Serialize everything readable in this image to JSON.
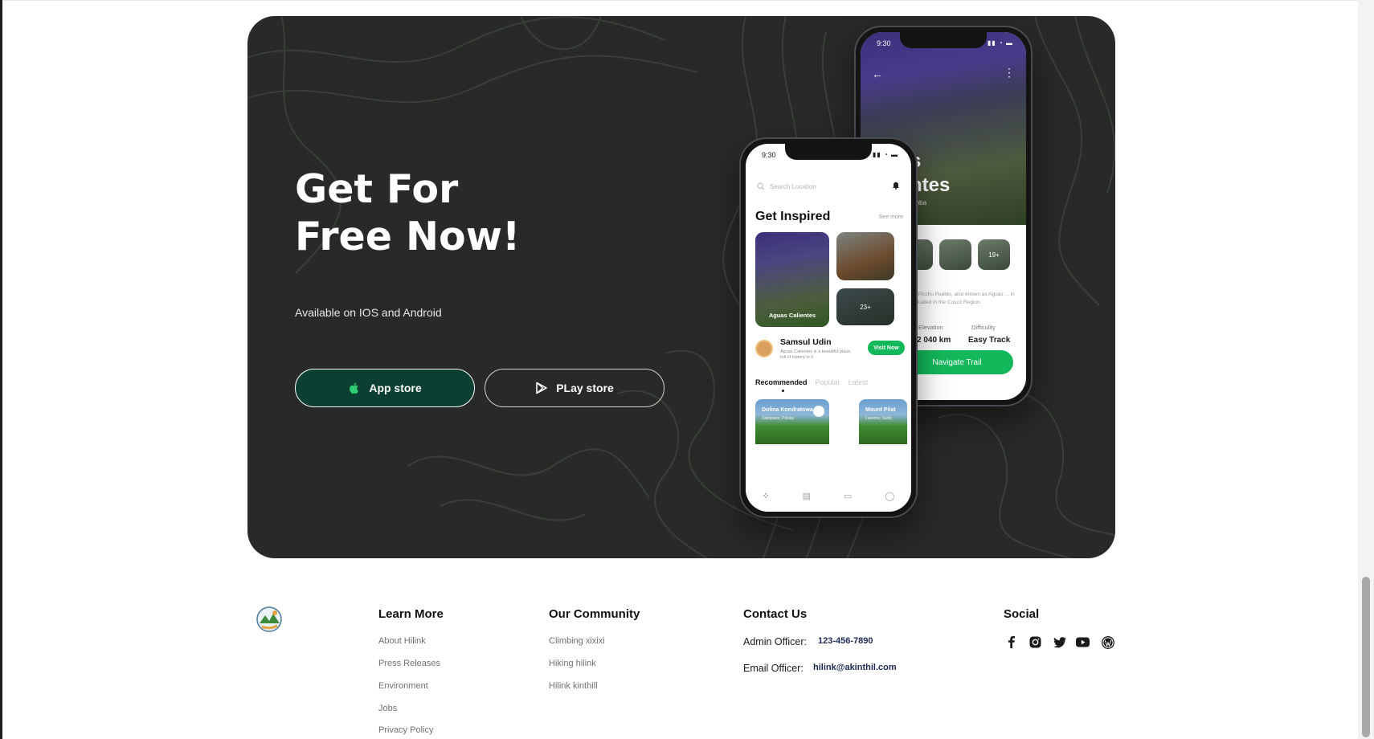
{
  "hero": {
    "headline_line1": "Get For",
    "headline_line2": "Free Now!",
    "subtitle": "Available on IOS and Android",
    "app_store_label": "App store",
    "play_store_label": "PLay store"
  },
  "phone_back": {
    "time": "9:30",
    "title_line1": "s",
    "title_line2": "ntes",
    "subtitle": "amba",
    "thumb_count": "19+",
    "description": "Machu Picchu Pueblo, also known as Aguas ... in Peru situated in the Cusco Region.",
    "elevation_label": "Elevation",
    "elevation_value": "2 040 km",
    "difficulty_label": "Difficulity",
    "difficulty_value": "Easy Track",
    "navigate_label": "Navigate Trail"
  },
  "phone_front": {
    "time": "9:30",
    "search_placeholder": "Search Location",
    "section_title": "Get Inspired",
    "see_more": "See more",
    "card_main_label": "Aguas Calientes",
    "card_count": "23+",
    "person_name": "Samsul Udin",
    "person_desc": "Aguas Calientes is a beautiful place, full of history in it",
    "visit_label": "Visit Now",
    "tabs": [
      "Recommended",
      "Popular",
      "Latest"
    ],
    "rec1_title": "Dolina Kondratowa",
    "rec1_sub": "Zakopane, Polska",
    "rec2_title": "Mount Pilat",
    "rec2_sub": "Lucerne, Switz"
  },
  "footer": {
    "learn_more": {
      "title": "Learn More",
      "links": [
        "About Hilink",
        "Press Releases",
        "Environment",
        "Jobs",
        "Privacy Policy"
      ]
    },
    "community": {
      "title": "Our Community",
      "links": [
        "Climbing xixixi",
        "Hiking hilink",
        "Hilink kinthill"
      ]
    },
    "contact": {
      "title": "Contact Us",
      "admin_label": "Admin Officer:",
      "admin_value": "123-456-7890",
      "email_label": "Email Officer:",
      "email_value": "hilink@akinthil.com"
    },
    "social": {
      "title": "Social",
      "icons": [
        "facebook-icon",
        "instagram-icon",
        "twitter-icon",
        "youtube-icon",
        "wordpress-icon"
      ]
    }
  },
  "colors": {
    "hero_bg": "#272a26",
    "app_button_bg": "#0b3f32",
    "accent_green": "#13b85a",
    "contact_value": "#1d2a55"
  }
}
